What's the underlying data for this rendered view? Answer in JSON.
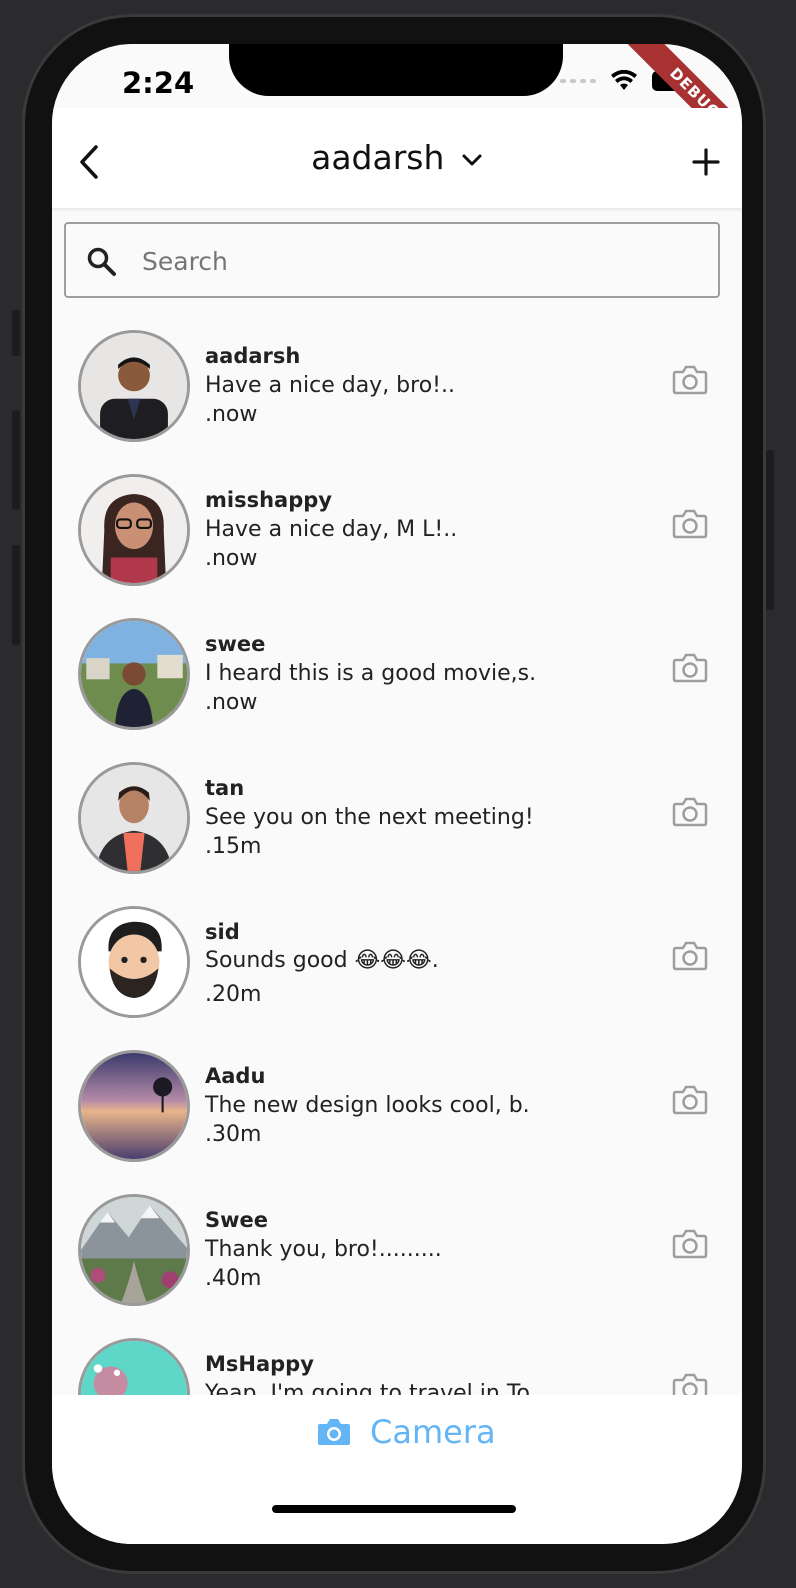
{
  "status": {
    "time": "2:24",
    "debug_label": "DEBUG"
  },
  "appbar": {
    "title": "aadarsh"
  },
  "search": {
    "placeholder": "Search"
  },
  "conversations": [
    {
      "name": "aadarsh",
      "message": "Have a nice day, bro!..",
      "time": ".now"
    },
    {
      "name": "misshappy",
      "message": "Have a nice day, M L!..",
      "time": ".now"
    },
    {
      "name": "swee",
      "message": "I heard this is a good movie,s.",
      "time": ".now"
    },
    {
      "name": "tan",
      "message": "See you on the next meeting!",
      "time": ".15m"
    },
    {
      "name": "sid",
      "message": "Sounds good 😂😂😂.",
      "time": ".20m"
    },
    {
      "name": "Aadu",
      "message": "The new design looks cool, b.",
      "time": ".30m"
    },
    {
      "name": "Swee",
      "message": "Thank you, bro!.........",
      "time": ".40m"
    },
    {
      "name": "MsHappy",
      "message": "Yeap, I'm going to travel in To",
      "time": ""
    }
  ],
  "bottom": {
    "camera_label": "Camera"
  },
  "colors": {
    "accent": "#64b5f6",
    "debug": "#a83232"
  },
  "icons": [
    "back-arrow-icon",
    "chevron-down-icon",
    "plus-icon",
    "search-icon",
    "camera-icon",
    "wifi-icon",
    "battery-icon"
  ]
}
